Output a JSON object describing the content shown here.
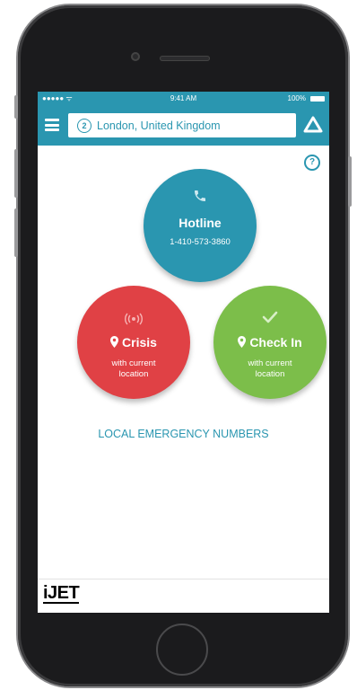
{
  "status": {
    "signal": "●●●●● ᯤ",
    "time": "9:41 AM",
    "battery": "100%"
  },
  "header": {
    "location_badge": "2",
    "location": "London, United Kingdom"
  },
  "buttons": {
    "hotline": {
      "title": "Hotline",
      "number": "1-410-573-3860"
    },
    "crisis": {
      "title": "Crisis",
      "sub1": "with current",
      "sub2": "location"
    },
    "checkin": {
      "title": "Check In",
      "sub1": "with current",
      "sub2": "location"
    }
  },
  "links": {
    "emergency": "LOCAL EMERGENCY NUMBERS"
  },
  "footer": {
    "logo": "iJET"
  },
  "icons": {
    "menu": "hamburger-icon",
    "alert": "alert-triangle-icon",
    "help": "help-icon",
    "phone": "phone-icon",
    "wireless": "wireless-signal-icon",
    "check": "check-icon",
    "pin": "map-pin-icon"
  },
  "colors": {
    "brand": "#2a96b0",
    "crisis": "#e04145",
    "checkin": "#7cbe4a"
  }
}
